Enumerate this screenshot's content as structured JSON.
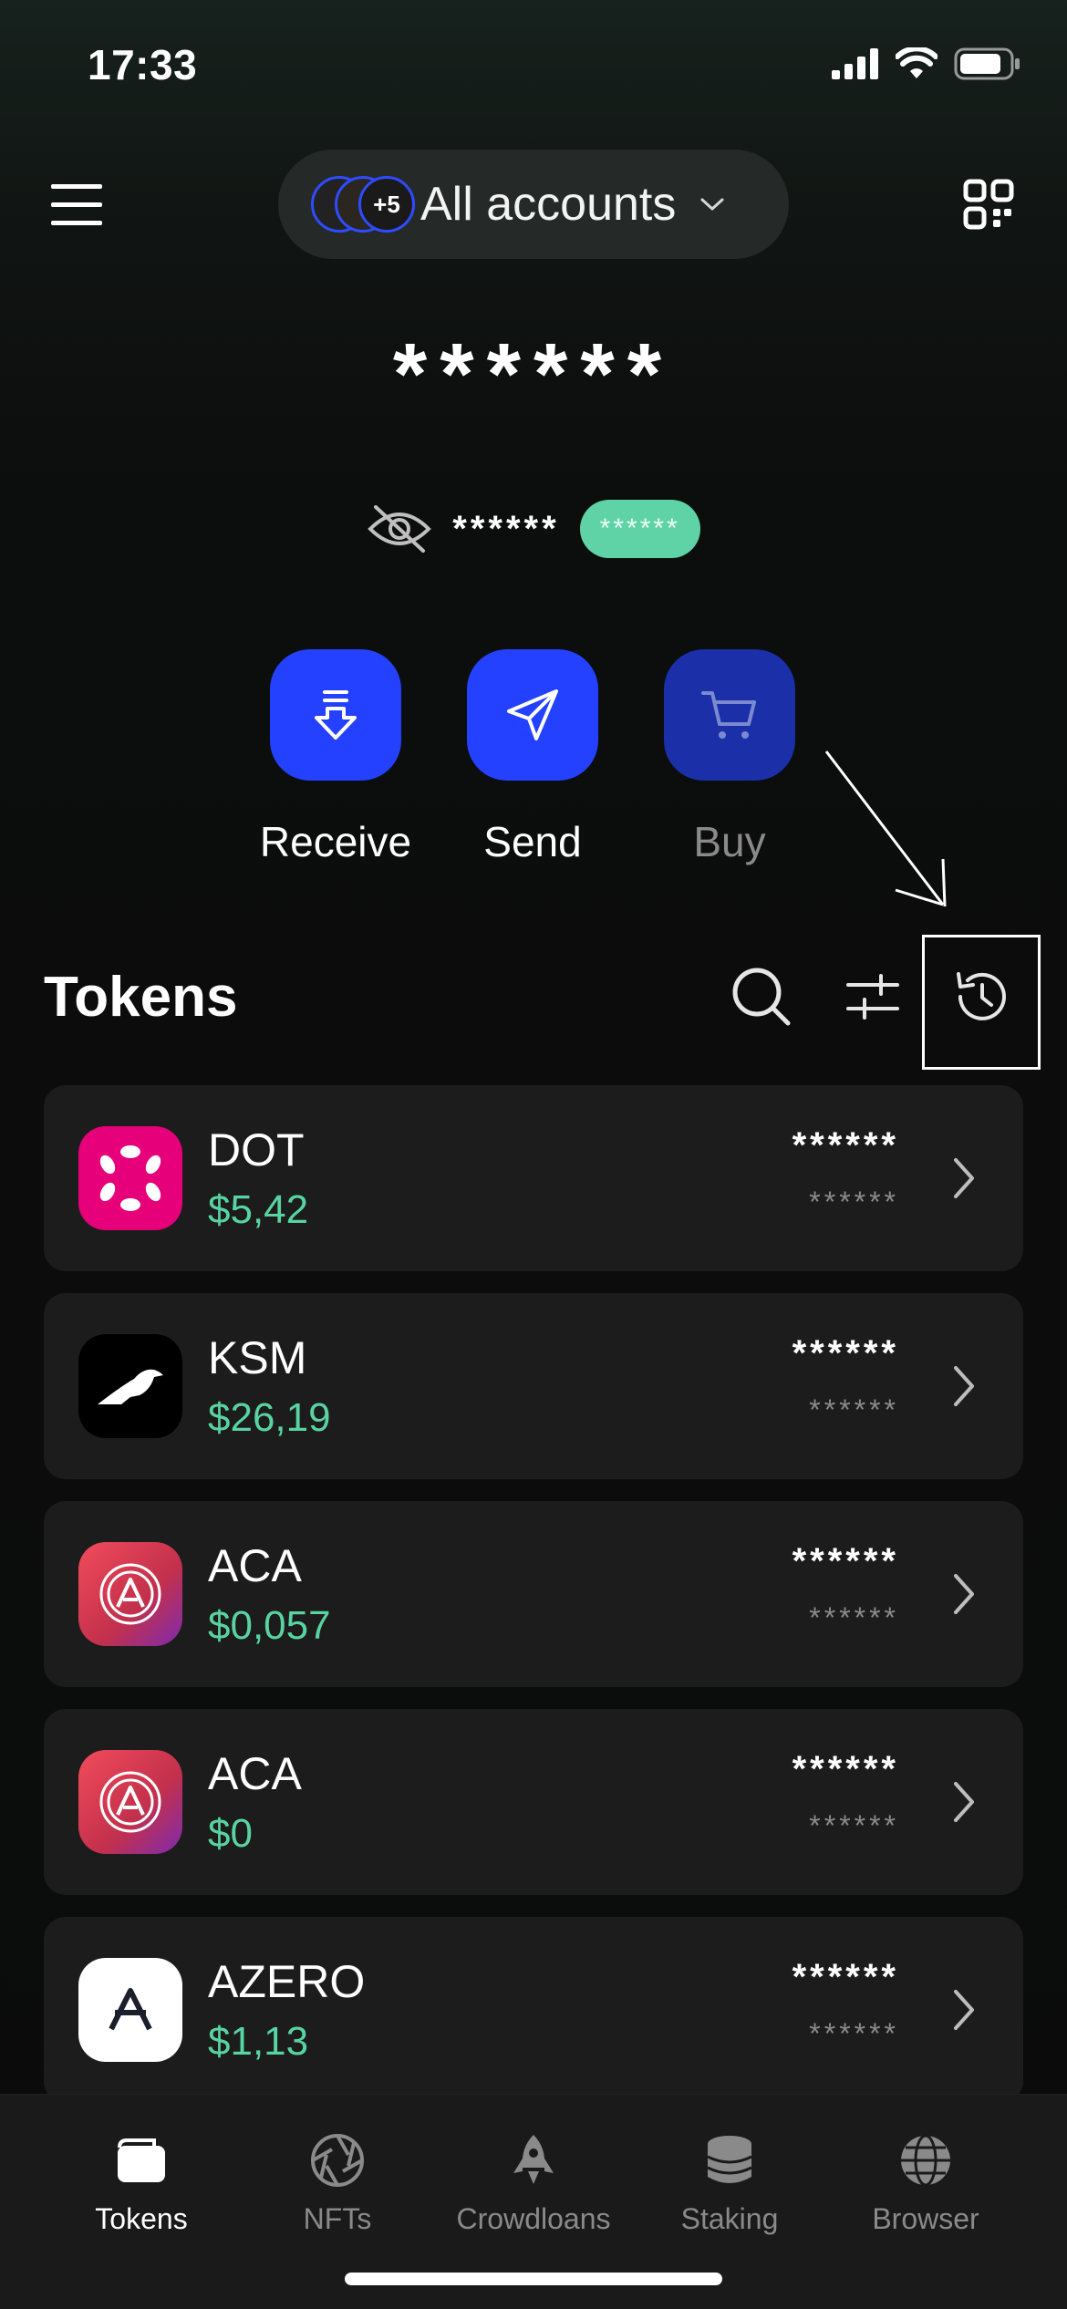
{
  "status": {
    "time": "17:33"
  },
  "header": {
    "account_label": "All accounts",
    "account_count_badge": "+5",
    "menu_icon": "hamburger-menu-icon",
    "qr_icon": "qr-scan-icon"
  },
  "balance": {
    "total": "******",
    "sub_value": "******",
    "sub_badge": "******"
  },
  "actions": [
    {
      "label": "Receive",
      "icon": "receive-icon",
      "enabled": true
    },
    {
      "label": "Send",
      "icon": "send-icon",
      "enabled": true
    },
    {
      "label": "Buy",
      "icon": "cart-icon",
      "enabled": false
    }
  ],
  "tokens_section": {
    "title": "Tokens",
    "icons": [
      "search-icon",
      "filter-sliders-icon",
      "history-icon"
    ]
  },
  "tokens": [
    {
      "symbol": "DOT",
      "price": "$5,42",
      "balance": "******",
      "balance_usd": "******",
      "logo": "polkadot-logo"
    },
    {
      "symbol": "KSM",
      "price": "$26,19",
      "balance": "******",
      "balance_usd": "******",
      "logo": "kusama-logo"
    },
    {
      "symbol": "ACA",
      "price": "$0,057",
      "balance": "******",
      "balance_usd": "******",
      "logo": "acala-logo"
    },
    {
      "symbol": "ACA",
      "price": "$0",
      "balance": "******",
      "balance_usd": "******",
      "logo": "acala-logo"
    },
    {
      "symbol": "AZERO",
      "price": "$1,13",
      "balance": "******",
      "balance_usd": "******",
      "logo": "aleph-zero-logo"
    }
  ],
  "tabbar": [
    {
      "label": "Tokens",
      "icon": "wallet-icon",
      "active": true
    },
    {
      "label": "NFTs",
      "icon": "aperture-icon",
      "active": false
    },
    {
      "label": "Crowdloans",
      "icon": "rocket-icon",
      "active": false
    },
    {
      "label": "Staking",
      "icon": "database-stack-icon",
      "active": false
    },
    {
      "label": "Browser",
      "icon": "globe-icon",
      "active": false
    }
  ],
  "colors": {
    "accent_blue": "#2441ff",
    "disabled_blue": "#1a2fa8",
    "price_green": "#57d4a2",
    "badge_green": "#5fd3a6",
    "card_bg": "#1c1c1c"
  }
}
